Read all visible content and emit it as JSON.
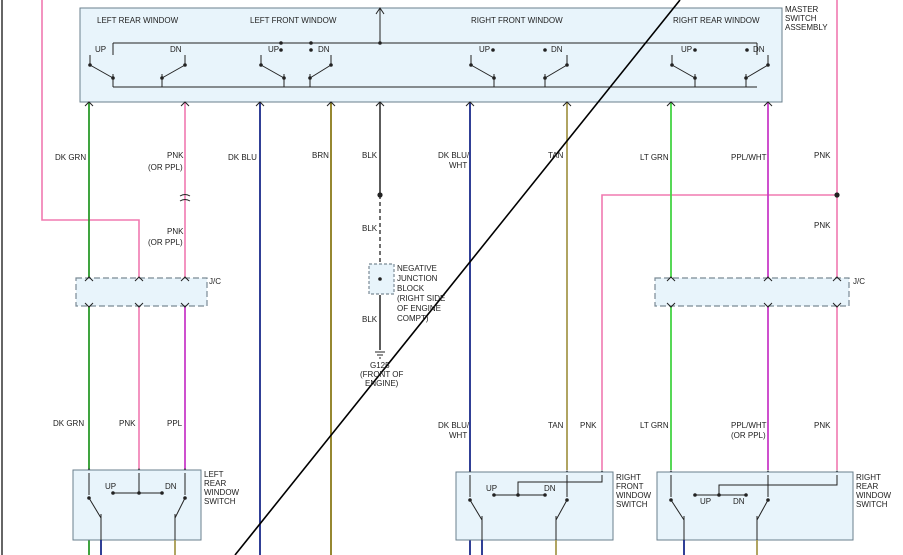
{
  "master": {
    "title": [
      "MASTER",
      "SWITCH",
      "ASSEMBLY"
    ],
    "sections": {
      "left_rear": "LEFT REAR WINDOW",
      "left_front": "LEFT FRONT WINDOW",
      "right_front": "RIGHT FRONT WINDOW",
      "right_rear": "RIGHT REAR WINDOW"
    },
    "up": "UP",
    "dn": "DN"
  },
  "wires": {
    "dk_grn": "DK GRN",
    "pnk": "PNK",
    "or_ppl": "(OR PPL)",
    "dk_blu": "DK BLU",
    "brn": "BRN",
    "blk": "BLK",
    "dk_blu_wht_1": "DK BLU/",
    "dk_blu_wht_2": "WHT",
    "tan": "TAN",
    "lt_grn": "LT GRN",
    "ppl_wht": "PPL/WHT",
    "ppl": "PPL"
  },
  "jc": "J/C",
  "junction": [
    "NEGATIVE",
    "JUNCTION",
    "BLOCK",
    "(RIGHT SIDE",
    "OF ENGINE",
    "COMPT)"
  ],
  "ground": [
    "G125",
    "(FRONT OF",
    "ENGINE)"
  ],
  "switches": {
    "left_rear": [
      "LEFT",
      "REAR",
      "WINDOW",
      "SWITCH"
    ],
    "right_front": [
      "RIGHT",
      "FRONT",
      "WINDOW",
      "SWITCH"
    ],
    "right_rear": [
      "RIGHT",
      "REAR",
      "WINDOW",
      "SWITCH"
    ]
  },
  "colors": {
    "dk_grn": "#2a9a2a",
    "pnk": "#f07ab0",
    "ppl": "#c83cc8",
    "dk_blu": "#1a2a8a",
    "brn": "#8a7a1a",
    "blk": "#333333",
    "tan": "#a89a50",
    "lt_grn": "#44d444"
  }
}
